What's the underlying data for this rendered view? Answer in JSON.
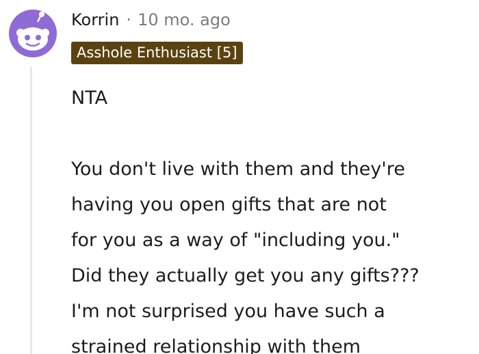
{
  "comment": {
    "author": "Korrin",
    "separator": "·",
    "timestamp": "10 mo. ago",
    "flair": "Asshole Enthusiast [5]",
    "flair_color": "#5a4210",
    "avatar_color": "#8f6bd6",
    "body": {
      "verdict": "NTA",
      "lines": [
        "You don't live with them and they're",
        "having you open gifts that are not",
        "for you as a way of \"including you.\"",
        "Did they actually get you any gifts???",
        "I'm not surprised you have such a",
        "strained relationship with them"
      ]
    }
  },
  "icons": {
    "avatar": "reddit-snoo-avatar-icon"
  }
}
